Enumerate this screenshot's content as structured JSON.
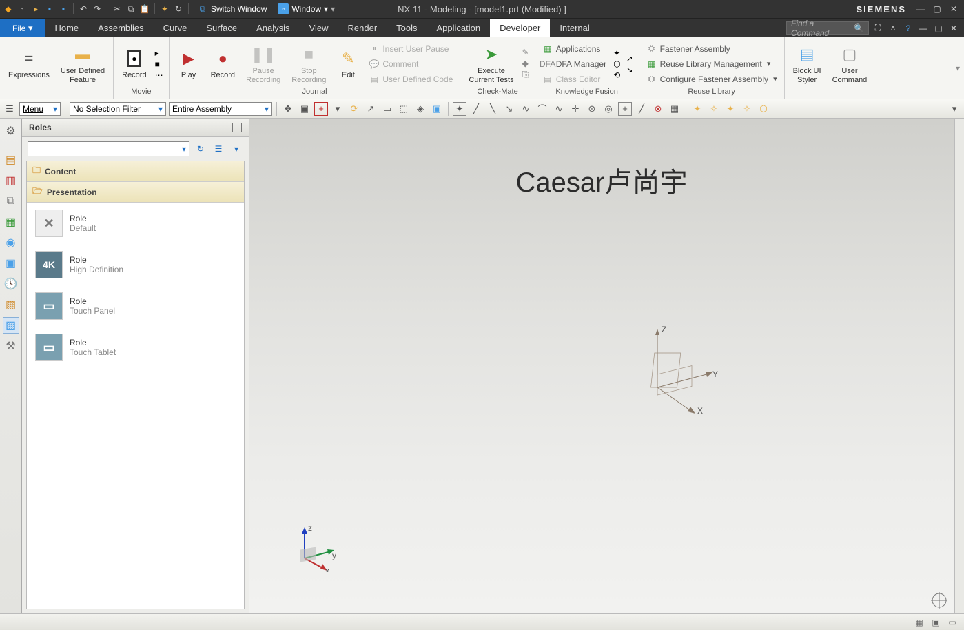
{
  "titlebar": {
    "switch_window": "Switch Window",
    "window": "Window",
    "title": "NX 11 - Modeling - [model1.prt (Modified) ]",
    "brand": "SIEMENS"
  },
  "menu": {
    "file": "File",
    "items": [
      "Home",
      "Assemblies",
      "Curve",
      "Surface",
      "Analysis",
      "View",
      "Render",
      "Tools",
      "Application",
      "Developer",
      "Internal"
    ],
    "active": "Developer",
    "find_placeholder": "Find a Command"
  },
  "ribbon": {
    "expressions": "Expressions",
    "user_defined_feature": "User Defined\nFeature",
    "record": "Record",
    "movie_label": "Movie",
    "play": "Play",
    "record2": "Record",
    "pause_rec": "Pause\nRecording",
    "stop_rec": "Stop\nRecording",
    "edit": "Edit",
    "insert_pause": "Insert User Pause",
    "comment": "Comment",
    "user_code": "User Defined Code",
    "journal_label": "Journal",
    "execute_tests": "Execute\nCurrent Tests",
    "check_mate": "Check-Mate",
    "applications": "Applications",
    "dfa_mgr": "DFA Manager",
    "class_editor": "Class Editor",
    "kf_label": "Knowledge Fusion",
    "fastener_asm": "Fastener Assembly",
    "reuse_lib_mgmt": "Reuse Library Management",
    "config_fastener": "Configure Fastener Assembly",
    "reuse_label": "Reuse Library",
    "block_ui": "Block UI\nStyler",
    "user_cmd": "User\nCommand"
  },
  "toolbar": {
    "menu": "Menu",
    "filter": "No Selection Filter",
    "scope": "Entire Assembly"
  },
  "roles": {
    "title": "Roles",
    "content": "Content",
    "presentation": "Presentation",
    "items": [
      {
        "t": "Role",
        "s": "Default",
        "ico": "✕"
      },
      {
        "t": "Role",
        "s": "High Definition",
        "ico": "4K"
      },
      {
        "t": "Role",
        "s": "Touch Panel",
        "ico": "▭"
      },
      {
        "t": "Role",
        "s": "Touch Tablet",
        "ico": "▭"
      }
    ]
  },
  "canvas": {
    "caption": "Caesar卢尚宇",
    "axes": {
      "x": "x",
      "y": "y",
      "z": "z"
    },
    "datum": {
      "x": "X",
      "y": "Y",
      "z": "Z"
    }
  }
}
